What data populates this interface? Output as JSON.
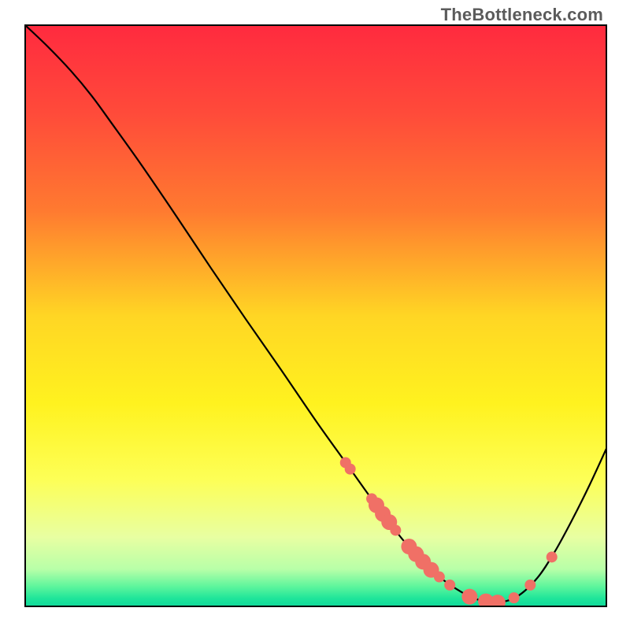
{
  "watermark": {
    "text": "TheBottleneck.com"
  },
  "chart_data": {
    "type": "line",
    "title": "",
    "xlabel": "",
    "ylabel": "",
    "xlim": [
      0,
      1
    ],
    "ylim": [
      0,
      1
    ],
    "grid": false,
    "legend": false,
    "background_gradient": {
      "direction": "vertical",
      "stops": [
        {
          "offset": 0.0,
          "color": "#ff2a3f"
        },
        {
          "offset": 0.15,
          "color": "#ff4a3a"
        },
        {
          "offset": 0.32,
          "color": "#ff7a30"
        },
        {
          "offset": 0.5,
          "color": "#ffd624"
        },
        {
          "offset": 0.65,
          "color": "#fff21f"
        },
        {
          "offset": 0.78,
          "color": "#fdff56"
        },
        {
          "offset": 0.88,
          "color": "#e8ffa2"
        },
        {
          "offset": 0.935,
          "color": "#b8ffa8"
        },
        {
          "offset": 0.965,
          "color": "#5cf59c"
        },
        {
          "offset": 0.985,
          "color": "#1fe59a"
        },
        {
          "offset": 1.0,
          "color": "#0fd89a"
        }
      ]
    },
    "series": [
      {
        "name": "bottleneck-curve",
        "color": "#000000",
        "stroke_width": 2.2,
        "points": [
          {
            "x": 0.0,
            "y": 1.0
          },
          {
            "x": 0.04,
            "y": 0.962
          },
          {
            "x": 0.08,
            "y": 0.92
          },
          {
            "x": 0.115,
            "y": 0.878
          },
          {
            "x": 0.15,
            "y": 0.83
          },
          {
            "x": 0.2,
            "y": 0.76
          },
          {
            "x": 0.26,
            "y": 0.672
          },
          {
            "x": 0.32,
            "y": 0.582
          },
          {
            "x": 0.38,
            "y": 0.494
          },
          {
            "x": 0.44,
            "y": 0.408
          },
          {
            "x": 0.5,
            "y": 0.32
          },
          {
            "x": 0.55,
            "y": 0.25
          },
          {
            "x": 0.6,
            "y": 0.18
          },
          {
            "x": 0.65,
            "y": 0.115
          },
          {
            "x": 0.7,
            "y": 0.062
          },
          {
            "x": 0.74,
            "y": 0.032
          },
          {
            "x": 0.775,
            "y": 0.014
          },
          {
            "x": 0.81,
            "y": 0.008
          },
          {
            "x": 0.845,
            "y": 0.018
          },
          {
            "x": 0.88,
            "y": 0.05
          },
          {
            "x": 0.91,
            "y": 0.095
          },
          {
            "x": 0.94,
            "y": 0.15
          },
          {
            "x": 0.97,
            "y": 0.21
          },
          {
            "x": 1.0,
            "y": 0.275
          }
        ]
      }
    ],
    "markers": {
      "color": "#f07066",
      "radius_small": 7,
      "radius_large": 10,
      "points": [
        {
          "x": 0.551,
          "y": 0.248,
          "r": 7
        },
        {
          "x": 0.559,
          "y": 0.237,
          "r": 7
        },
        {
          "x": 0.596,
          "y": 0.186,
          "r": 7
        },
        {
          "x": 0.604,
          "y": 0.175,
          "r": 10
        },
        {
          "x": 0.615,
          "y": 0.16,
          "r": 10
        },
        {
          "x": 0.626,
          "y": 0.146,
          "r": 10
        },
        {
          "x": 0.637,
          "y": 0.132,
          "r": 7
        },
        {
          "x": 0.66,
          "y": 0.104,
          "r": 10
        },
        {
          "x": 0.672,
          "y": 0.091,
          "r": 10
        },
        {
          "x": 0.684,
          "y": 0.078,
          "r": 10
        },
        {
          "x": 0.698,
          "y": 0.064,
          "r": 10
        },
        {
          "x": 0.712,
          "y": 0.052,
          "r": 7
        },
        {
          "x": 0.73,
          "y": 0.038,
          "r": 7
        },
        {
          "x": 0.764,
          "y": 0.018,
          "r": 10
        },
        {
          "x": 0.792,
          "y": 0.01,
          "r": 10
        },
        {
          "x": 0.812,
          "y": 0.008,
          "r": 10
        },
        {
          "x": 0.84,
          "y": 0.016,
          "r": 7
        },
        {
          "x": 0.868,
          "y": 0.038,
          "r": 7
        },
        {
          "x": 0.905,
          "y": 0.086,
          "r": 7
        }
      ]
    }
  }
}
